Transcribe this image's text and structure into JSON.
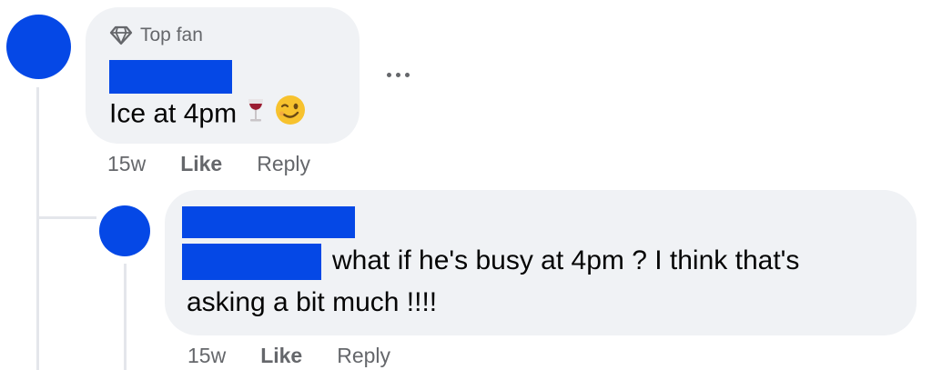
{
  "comment": {
    "badge_label": "Top fan",
    "badge_icon": "diamond-icon",
    "text": "Ice at 4pm",
    "emojis": [
      "wine-glass-emoji",
      "winking-face-emoji"
    ],
    "more_icon": "more-options-icon",
    "time": "15w",
    "like_label": "Like",
    "reply_label": "Reply"
  },
  "reply": {
    "text_line1": "what if he's busy at 4pm ? I think that's",
    "text_line2": "asking a bit much !!!!",
    "time": "15w",
    "like_label": "Like",
    "reply_label": "Reply"
  },
  "colors": {
    "redaction_blue": "#0548e6",
    "bubble_bg": "#f0f2f5",
    "meta_gray": "#65676b"
  }
}
